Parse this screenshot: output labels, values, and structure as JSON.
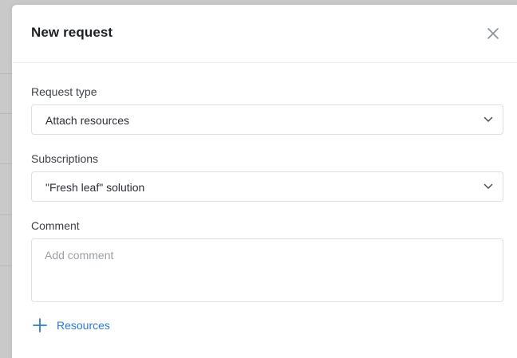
{
  "modal": {
    "title": "New request",
    "close_icon": "close-icon"
  },
  "fields": {
    "request_type": {
      "label": "Request type",
      "value": "Attach resources"
    },
    "subscriptions": {
      "label": "Subscriptions",
      "value": "\"Fresh leaf\" solution"
    },
    "comment": {
      "label": "Comment",
      "placeholder": "Add comment",
      "value": ""
    }
  },
  "actions": {
    "add_resources_label": "Resources",
    "add_icon": "plus-icon"
  },
  "colors": {
    "accent": "#2a7ad6",
    "border": "#dcdfe4",
    "text": "#2b2f35",
    "muted": "#9aa0a8"
  }
}
